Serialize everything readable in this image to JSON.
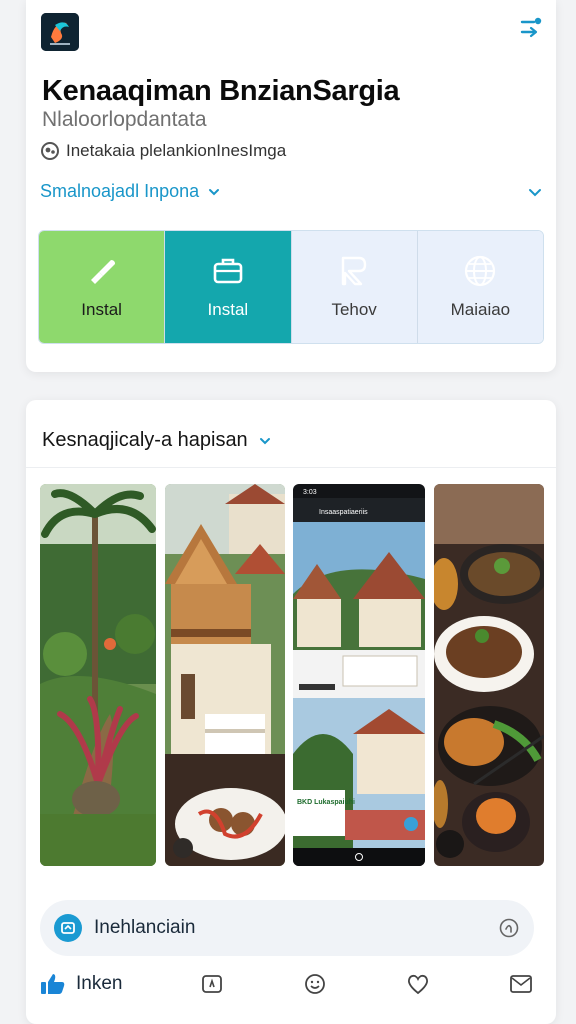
{
  "header": {
    "app_title": "Kenaaqiman BnzianSargia",
    "app_subtitle": "Nlaloorlopdantata",
    "meta_text": "Inetakaia plelankionInesImga",
    "category_label": "Smalnoajadl Inpona"
  },
  "actions": [
    {
      "label": "Instal",
      "icon": "brush-icon",
      "color": "#8ed96d"
    },
    {
      "label": "Instal",
      "icon": "briefcase-icon",
      "color": "#14a7ad"
    },
    {
      "label": "Tehov",
      "icon": "flag-icon",
      "color": "#e9f0fb"
    },
    {
      "label": "Maiaiao",
      "icon": "globe-icon",
      "color": "#e9f0fb"
    }
  ],
  "gallery": {
    "heading": "Kesnaqjicaly-a hapisan",
    "screenshots": [
      {
        "name": "garden-photo"
      },
      {
        "name": "traditional-house-photo"
      },
      {
        "name": "app-screen-photo",
        "status_time": "3:03",
        "screen_title": "Insaaspatiaeriis",
        "card_text": "BKD Lukaspaiuhi"
      },
      {
        "name": "food-photo"
      }
    ]
  },
  "footer": {
    "search_label": "Inehlanciain",
    "like_label": "Inken"
  },
  "colors": {
    "accent_blue": "#1996c9",
    "green": "#8ed96d",
    "teal": "#14a7ad",
    "pale_blue": "#e9f0fb"
  }
}
